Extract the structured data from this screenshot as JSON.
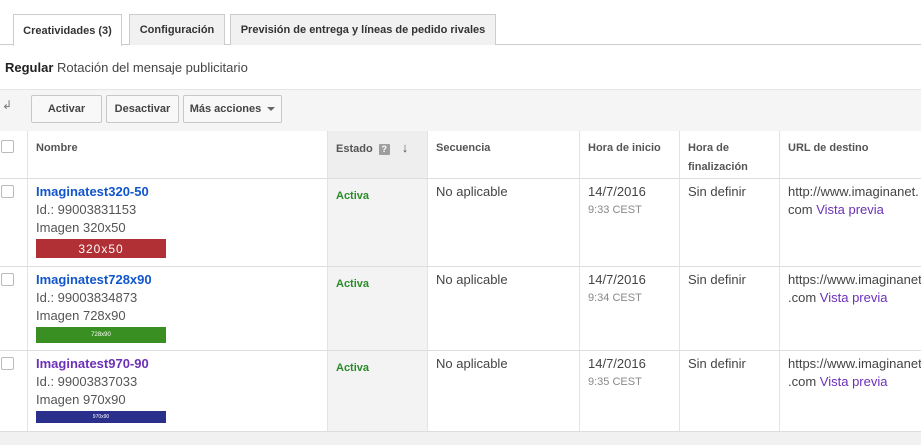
{
  "tabs": [
    {
      "label": "Creatividades (3)",
      "active": true
    },
    {
      "label": "Configuración",
      "active": false
    },
    {
      "label": "Previsión de entrega y líneas de pedido rivales",
      "active": false
    }
  ],
  "rotation": {
    "bold": "Regular",
    "text": "Rotación del mensaje publicitario"
  },
  "toolbar": {
    "activate": "Activar",
    "deactivate": "Desactivar",
    "more": "Más acciones"
  },
  "columns": {
    "name": "Nombre",
    "status": "Estado",
    "help": "?",
    "sequence": "Secuencia",
    "start": "Hora de inicio",
    "end_line1": "Hora de",
    "end_line2": "finalización",
    "url": "URL de destino"
  },
  "rows": [
    {
      "name": "Imaginatest320-50",
      "id": "Id.: 99003831153",
      "size": "Imagen 320x50",
      "thumb_label": "320x50",
      "thumb_color": "#b03035",
      "status": "Activa",
      "sequence": "No aplicable",
      "start_date": "14/7/2016",
      "start_time": "9:33 CEST",
      "end": "Sin definir",
      "url_line1": "http://www.imaginanet.",
      "url_line2": "com",
      "preview": "Vista previa"
    },
    {
      "name": "Imaginatest728x90",
      "id": "Id.: 99003834873",
      "size": "Imagen 728x90",
      "thumb_label": "728x90",
      "thumb_color": "#3a8f22",
      "status": "Activa",
      "sequence": "No aplicable",
      "start_date": "14/7/2016",
      "start_time": "9:34 CEST",
      "end": "Sin definir",
      "url_line1": "https://www.imaginanet",
      "url_line2": ".com",
      "preview": "Vista previa"
    },
    {
      "name": "Imaginatest970-90",
      "id": "Id.: 99003837033",
      "size": "Imagen 970x90",
      "thumb_label": "970x90",
      "thumb_color": "#2b2f8c",
      "status": "Activa",
      "sequence": "No aplicable",
      "start_date": "14/7/2016",
      "start_time": "9:35 CEST",
      "end": "Sin definir",
      "url_line1": "https://www.imaginanet",
      "url_line2": ".com",
      "preview": "Vista previa"
    }
  ]
}
